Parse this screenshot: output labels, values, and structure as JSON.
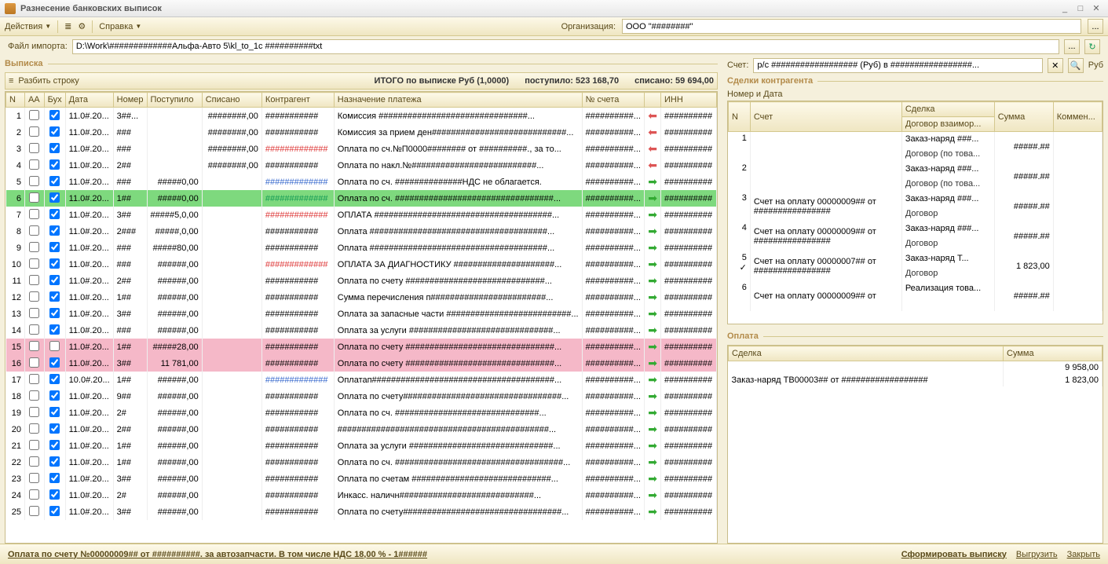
{
  "window": {
    "title": "Разнесение банковских выписок"
  },
  "toolbar": {
    "actions": "Действия",
    "help": "Справка",
    "org_label": "Организация:",
    "org_value": "ООО \"########\""
  },
  "file": {
    "label": "Файл импорта:",
    "value": "D:\\Work\\#############Альфа-Авто 5\\kl_to_1c ##########txt"
  },
  "vypiska": {
    "title": "Выписка",
    "split": "Разбить строку",
    "summary_label": "ИТОГО по выписке Руб (1,0000)",
    "incoming_label": "поступило: 523 168,70",
    "outgoing_label": "списано: 59 694,00",
    "cols": {
      "n": "N",
      "aa": "АА",
      "buh": "Бух",
      "date": "Дата",
      "num": "Номер",
      "incoming": "Поступило",
      "out": "Списано",
      "contr": "Контрагент",
      "purpose": "Назначение платежа",
      "acc": "№ счета",
      "inn": "ИНН"
    },
    "rows": [
      {
        "n": 1,
        "aa": false,
        "buh": true,
        "date": "11.0#.20...",
        "num": "3##...",
        "incoming": "",
        "out": "########,00",
        "contr": "###########",
        "contr_cls": "",
        "purpose": "Комиссия ###############################...",
        "acc": "##########...",
        "dir": "l",
        "inn": "##########"
      },
      {
        "n": 2,
        "aa": false,
        "buh": true,
        "date": "11.0#.20...",
        "num": "###",
        "incoming": "",
        "out": "########,00",
        "contr": "###########",
        "contr_cls": "",
        "purpose": "Комиссия за прием ден############################...",
        "acc": "##########...",
        "dir": "l",
        "inn": "##########"
      },
      {
        "n": 3,
        "aa": false,
        "buh": true,
        "date": "11.0#.20...",
        "num": "###",
        "incoming": "",
        "out": "########,00",
        "contr": "#############",
        "contr_cls": "txt-red",
        "purpose": "Оплата по сч.№П0000######## от ##########., за то...",
        "acc": "##########...",
        "dir": "l",
        "inn": "##########"
      },
      {
        "n": 4,
        "aa": false,
        "buh": true,
        "date": "11.0#.20...",
        "num": "2##",
        "incoming": "",
        "out": "########,00",
        "contr": "###########",
        "contr_cls": "",
        "purpose": "Оплата по накл.№##########################...",
        "acc": "##########...",
        "dir": "l",
        "inn": "##########"
      },
      {
        "n": 5,
        "aa": false,
        "buh": true,
        "date": "11.0#.20...",
        "num": "###",
        "incoming": "#####0,00",
        "out": "",
        "contr": "#############",
        "contr_cls": "txt-blue",
        "purpose": "Оплата по сч. ##############НДС не облагается.",
        "acc": "##########...",
        "dir": "r",
        "inn": "##########"
      },
      {
        "n": 6,
        "aa": false,
        "buh": true,
        "date": "11.0#.20...",
        "num": "1##",
        "incoming": "#####0,00",
        "out": "",
        "contr": "#############",
        "contr_cls": "txt-green",
        "purpose": "Оплата по сч. #################################...",
        "acc": "##########...",
        "dir": "r",
        "inn": "##########",
        "cls": "green"
      },
      {
        "n": 7,
        "aa": false,
        "buh": true,
        "date": "11.0#.20...",
        "num": "3##",
        "incoming": "#####5,0,00",
        "out": "",
        "contr": "#############",
        "contr_cls": "txt-red",
        "purpose": "ОПЛАТА #####################################...",
        "acc": "##########...",
        "dir": "r",
        "inn": "##########"
      },
      {
        "n": 8,
        "aa": false,
        "buh": true,
        "date": "11.0#.20...",
        "num": "2###",
        "incoming": "#####,0,00",
        "out": "",
        "contr": "###########",
        "contr_cls": "",
        "purpose": "Оплата #####################################...",
        "acc": "##########...",
        "dir": "r",
        "inn": "##########"
      },
      {
        "n": 9,
        "aa": false,
        "buh": true,
        "date": "11.0#.20...",
        "num": "###",
        "incoming": "#####80,00",
        "out": "",
        "contr": "###########",
        "contr_cls": "",
        "purpose": "Оплата #####################################...",
        "acc": "##########...",
        "dir": "r",
        "inn": "##########"
      },
      {
        "n": 10,
        "aa": false,
        "buh": true,
        "date": "11.0#.20...",
        "num": "###",
        "incoming": "######,00",
        "out": "",
        "contr": "#############",
        "contr_cls": "txt-red",
        "purpose": "ОПЛАТА ЗА ДИАГНОСТИКУ #####################...",
        "acc": "##########...",
        "dir": "r",
        "inn": "##########"
      },
      {
        "n": 11,
        "aa": false,
        "buh": true,
        "date": "11.0#.20...",
        "num": "2##",
        "incoming": "######,00",
        "out": "",
        "contr": "###########",
        "contr_cls": "",
        "purpose": "Оплата по счету #############################...",
        "acc": "##########...",
        "dir": "r",
        "inn": "##########"
      },
      {
        "n": 12,
        "aa": false,
        "buh": true,
        "date": "11.0#.20...",
        "num": "1##",
        "incoming": "######,00",
        "out": "",
        "contr": "###########",
        "contr_cls": "",
        "purpose": "Сумма перечисления п########################...",
        "acc": "##########...",
        "dir": "r",
        "inn": "##########"
      },
      {
        "n": 13,
        "aa": false,
        "buh": true,
        "date": "11.0#.20...",
        "num": "3##",
        "incoming": "######,00",
        "out": "",
        "contr": "###########",
        "contr_cls": "",
        "purpose": "Оплата за запасные части ##########################...",
        "acc": "##########...",
        "dir": "r",
        "inn": "##########"
      },
      {
        "n": 14,
        "aa": false,
        "buh": true,
        "date": "11.0#.20...",
        "num": "###",
        "incoming": "######,00",
        "out": "",
        "contr": "###########",
        "contr_cls": "",
        "purpose": "Оплата за услуги ##############################...",
        "acc": "##########...",
        "dir": "r",
        "inn": "##########"
      },
      {
        "n": 15,
        "aa": false,
        "buh": false,
        "date": "11.0#.20...",
        "num": "1##",
        "incoming": "#####28,00",
        "out": "",
        "contr": "###########",
        "contr_cls": "",
        "purpose": "Оплата по счету ###############################...",
        "acc": "##########...",
        "dir": "r",
        "inn": "##########",
        "cls": "pink"
      },
      {
        "n": 16,
        "aa": false,
        "buh": true,
        "date": "11.0#.20...",
        "num": "3##",
        "incoming": "11 781,00",
        "out": "",
        "contr": "###########",
        "contr_cls": "",
        "purpose": "Оплата по счету ###############################...",
        "acc": "##########...",
        "dir": "r",
        "inn": "##########",
        "cls": "pink"
      },
      {
        "n": 17,
        "aa": false,
        "buh": true,
        "date": "10.0#.20...",
        "num": "1##",
        "incoming": "######,00",
        "out": "",
        "contr": "#############",
        "contr_cls": "txt-blue",
        "purpose": "Оплатап######################################...",
        "acc": "##########...",
        "dir": "r",
        "inn": "##########"
      },
      {
        "n": 18,
        "aa": false,
        "buh": true,
        "date": "11.0#.20...",
        "num": "9##",
        "incoming": "######,00",
        "out": "",
        "contr": "###########",
        "contr_cls": "",
        "purpose": "Оплата по счету#################################...",
        "acc": "##########...",
        "dir": "r",
        "inn": "##########"
      },
      {
        "n": 19,
        "aa": false,
        "buh": true,
        "date": "11.0#.20...",
        "num": "2#",
        "incoming": "######,00",
        "out": "",
        "contr": "###########",
        "contr_cls": "",
        "purpose": "Оплата по сч. ##############################...",
        "acc": "##########...",
        "dir": "r",
        "inn": "##########"
      },
      {
        "n": 20,
        "aa": false,
        "buh": true,
        "date": "11.0#.20...",
        "num": "2##",
        "incoming": "######,00",
        "out": "",
        "contr": "###########",
        "contr_cls": "",
        "purpose": "############################################...",
        "acc": "##########...",
        "dir": "r",
        "inn": "##########"
      },
      {
        "n": 21,
        "aa": false,
        "buh": true,
        "date": "11.0#.20...",
        "num": "1##",
        "incoming": "######,00",
        "out": "",
        "contr": "###########",
        "contr_cls": "",
        "purpose": "Оплата за услуги ##############################...",
        "acc": "##########...",
        "dir": "r",
        "inn": "##########"
      },
      {
        "n": 22,
        "aa": false,
        "buh": true,
        "date": "11.0#.20...",
        "num": "1##",
        "incoming": "######,00",
        "out": "",
        "contr": "###########",
        "contr_cls": "",
        "purpose": "Оплата по сч. ###################################...",
        "acc": "##########...",
        "dir": "r",
        "inn": "##########"
      },
      {
        "n": 23,
        "aa": false,
        "buh": true,
        "date": "11.0#.20...",
        "num": "3##",
        "incoming": "######,00",
        "out": "",
        "contr": "###########",
        "contr_cls": "",
        "purpose": "Оплата по счетам #############################...",
        "acc": "##########...",
        "dir": "r",
        "inn": "##########"
      },
      {
        "n": 24,
        "aa": false,
        "buh": true,
        "date": "11.0#.20...",
        "num": "2#",
        "incoming": "######,00",
        "out": "",
        "contr": "###########",
        "contr_cls": "",
        "purpose": "Инкасс. наличн############################...",
        "acc": "##########...",
        "dir": "r",
        "inn": "##########"
      },
      {
        "n": 25,
        "aa": false,
        "buh": true,
        "date": "11.0#.20...",
        "num": "3##",
        "incoming": "######,00",
        "out": "",
        "contr": "###########",
        "contr_cls": "",
        "purpose": "Оплата по счету#################################...",
        "acc": "##########...",
        "dir": "r",
        "inn": "##########"
      }
    ]
  },
  "account": {
    "label": "Счет:",
    "value": "р/с ################## (Руб) в #################...",
    "x": "✕",
    "lookup": "🔍",
    "suffix": "Руб"
  },
  "deals": {
    "title": "Сделки контрагента",
    "subtitle": "Номер и Дата",
    "cols": {
      "n": "N",
      "acct": "Счет",
      "deal": "Сделка",
      "contract": "Договор взаимор...",
      "sum": "Сумма",
      "comment": "Коммен..."
    },
    "rows": [
      {
        "n": 1,
        "acct": "",
        "deal": "Заказ-наряд ###...",
        "sum": "#####.##",
        "sub": "Договор (по това..."
      },
      {
        "n": 2,
        "acct": "",
        "deal": "Заказ-наряд ###...",
        "sum": "#####.##",
        "sub": "Договор (по това..."
      },
      {
        "n": 3,
        "acct": "Счет на оплату 00000009## от ################",
        "deal": "Заказ-наряд ###...",
        "sum": "#####.##",
        "sub": "Договор"
      },
      {
        "n": 4,
        "acct": "Счет на оплату 00000009## от ################",
        "deal": "Заказ-наряд ###...",
        "sum": "#####.##",
        "sub": "Договор"
      },
      {
        "n": 5,
        "acct": "Счет на оплату 00000007## от ################",
        "deal": "Заказ-наряд Т...",
        "sum": "1 823,00",
        "sub": "Договор",
        "selected": true
      },
      {
        "n": 6,
        "acct": "Счет на оплату 00000009## от",
        "deal": "Реализация това...",
        "sum": "#####.##",
        "sub": ""
      }
    ]
  },
  "payment": {
    "title": "Оплата",
    "cols": {
      "deal": "Сделка",
      "sum": "Сумма"
    },
    "rows": [
      {
        "deal": "",
        "sum": "9 958,00"
      },
      {
        "deal": "Заказ-наряд ТВ00003## от ##################",
        "sum": "1 823,00"
      }
    ]
  },
  "footer": {
    "link": "Оплата по счету №00000009## от ##########. за автозапчасти. В том числе НДС 18,00 % - 1######",
    "form": "Сформировать выписку",
    "export": "Выгрузить",
    "close": "Закрыть"
  }
}
